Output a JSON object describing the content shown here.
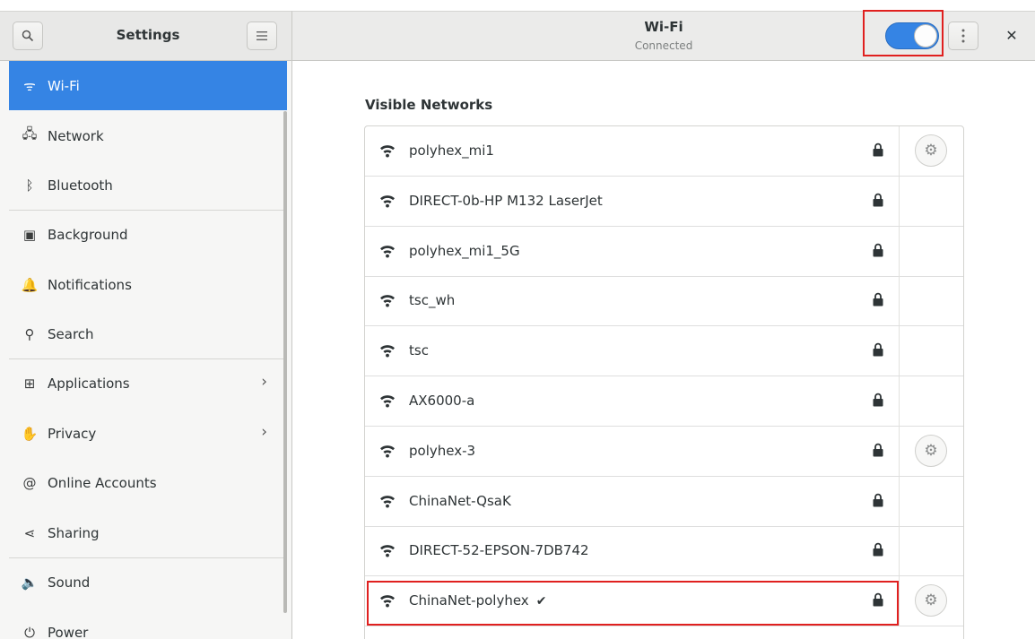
{
  "sidebar_header": {
    "title": "Settings"
  },
  "header": {
    "title": "Wi-Fi",
    "subtitle": "Connected",
    "wifi_enabled": true
  },
  "sidebar": {
    "items": [
      {
        "label": "Wi-Fi",
        "icon": "wifi-icon",
        "active": true
      },
      {
        "label": "Network",
        "icon": "network-icon"
      },
      {
        "label": "Bluetooth",
        "icon": "bluetooth-icon"
      },
      {
        "label": "Background",
        "icon": "background-icon"
      },
      {
        "label": "Notifications",
        "icon": "bell-icon"
      },
      {
        "label": "Search",
        "icon": "search-icon"
      },
      {
        "label": "Applications",
        "icon": "apps-grid-icon",
        "chevron": true
      },
      {
        "label": "Privacy",
        "icon": "hand-icon",
        "chevron": true
      },
      {
        "label": "Online Accounts",
        "icon": "at-sign-icon"
      },
      {
        "label": "Sharing",
        "icon": "share-icon"
      },
      {
        "label": "Sound",
        "icon": "speaker-icon"
      },
      {
        "label": "Power",
        "icon": "power-icon"
      }
    ]
  },
  "main": {
    "section_title": "Visible Networks",
    "networks": [
      {
        "name": "polyhex_mi1",
        "secured": true,
        "has_settings": true,
        "connected": false
      },
      {
        "name": "DIRECT-0b-HP M132 LaserJet",
        "secured": true,
        "has_settings": false,
        "connected": false
      },
      {
        "name": "polyhex_mi1_5G",
        "secured": true,
        "has_settings": false,
        "connected": false
      },
      {
        "name": "tsc_wh",
        "secured": true,
        "has_settings": false,
        "connected": false
      },
      {
        "name": "tsc",
        "secured": true,
        "has_settings": false,
        "connected": false
      },
      {
        "name": "AX6000-a",
        "secured": true,
        "has_settings": false,
        "connected": false
      },
      {
        "name": "polyhex-3",
        "secured": true,
        "has_settings": true,
        "connected": false
      },
      {
        "name": "ChinaNet-QsaK",
        "secured": true,
        "has_settings": false,
        "connected": false
      },
      {
        "name": "DIRECT-52-EPSON-7DB742",
        "secured": true,
        "has_settings": false,
        "connected": false
      },
      {
        "name": "ChinaNet-polyhex",
        "secured": true,
        "has_settings": true,
        "connected": true,
        "check": "✔"
      }
    ]
  },
  "colors": {
    "accent": "#3584e4",
    "highlight": "#e0201f"
  }
}
